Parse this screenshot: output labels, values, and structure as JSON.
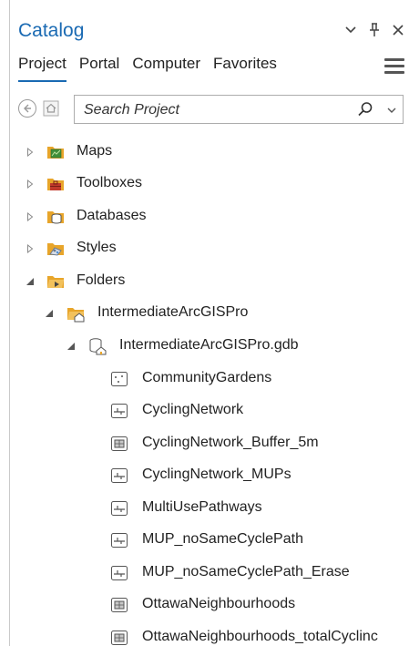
{
  "panel": {
    "title": "Catalog",
    "controls": {
      "options": "chevron-down-icon",
      "pin": "pin-icon",
      "close": "close-icon"
    }
  },
  "tabs": [
    {
      "label": "Project",
      "active": true
    },
    {
      "label": "Portal",
      "active": false
    },
    {
      "label": "Computer",
      "active": false
    },
    {
      "label": "Favorites",
      "active": false
    }
  ],
  "search": {
    "placeholder": "Search Project",
    "value": ""
  },
  "colors": {
    "accent": "#1a6ab3",
    "folder": "#e8a52a",
    "map_green": "#3f8f3a",
    "toolbox_red": "#c0392b"
  },
  "tree": {
    "maps": "Maps",
    "toolboxes": "Toolboxes",
    "databases": "Databases",
    "styles": "Styles",
    "folders": "Folders",
    "project_folder": "IntermediateArcGISPro",
    "gdb": "IntermediateArcGISPro.gdb",
    "items": [
      {
        "label": "CommunityGardens",
        "icon": "point-feature-class-icon"
      },
      {
        "label": "CyclingNetwork",
        "icon": "line-feature-class-icon"
      },
      {
        "label": "CyclingNetwork_Buffer_5m",
        "icon": "polygon-feature-class-icon"
      },
      {
        "label": "CyclingNetwork_MUPs",
        "icon": "line-feature-class-icon"
      },
      {
        "label": "MultiUsePathways",
        "icon": "line-feature-class-icon"
      },
      {
        "label": "MUP_noSameCyclePath",
        "icon": "line-feature-class-icon"
      },
      {
        "label": "MUP_noSameCyclePath_Erase",
        "icon": "line-feature-class-icon"
      },
      {
        "label": "OttawaNeighbourhoods",
        "icon": "polygon-feature-class-icon"
      },
      {
        "label": "OttawaNeighbourhoods_totalCyclinc",
        "icon": "polygon-feature-class-icon"
      }
    ]
  }
}
